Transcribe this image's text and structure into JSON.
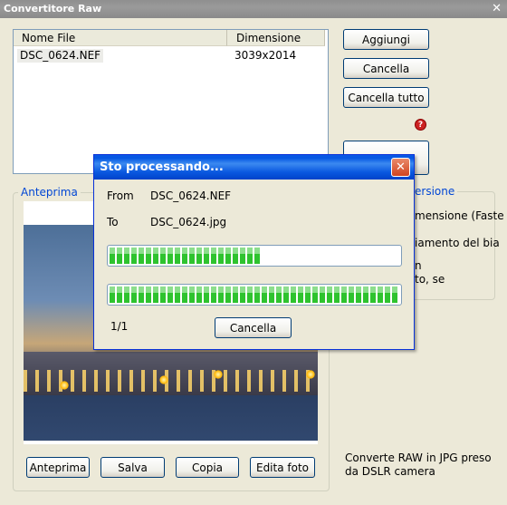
{
  "window": {
    "title": "Convertitore Raw",
    "close_glyph": "✕"
  },
  "file_list": {
    "headers": {
      "name": "Nome File",
      "size": "Dimensione"
    },
    "rows": [
      {
        "name": "DSC_0624.NEF",
        "size": "3039x2014"
      }
    ]
  },
  "buttons": {
    "add": "Aggiungi",
    "delete": "Cancella",
    "delete_all": "Cancella tutto",
    "preview": "Anteprima",
    "save": "Salva",
    "copy": "Copia",
    "edit": "Edita foto"
  },
  "help_icon": "?",
  "preview_group": {
    "title": "Anteprima"
  },
  "options_group": {
    "title": "ersione",
    "line1": "mensione (Faste",
    "line2": "iamento del bia",
    "line3": "n",
    "line4": "to, se"
  },
  "description": "Converte RAW in JPG preso da DSLR camera",
  "dialog": {
    "title": "Sto processando...",
    "close_glyph": "✕",
    "from_label": "From",
    "from_value": "DSC_0624.NEF",
    "to_label": "To",
    "to_value": "DSC_0624.jpg",
    "file_progress": 0.52,
    "total_progress": 1.0,
    "count": "1/1",
    "cancel": "Cancella"
  },
  "colors": {
    "accent": "#0046d5",
    "progress": "#2ec32e",
    "title_blue": "#0a5ae6"
  }
}
